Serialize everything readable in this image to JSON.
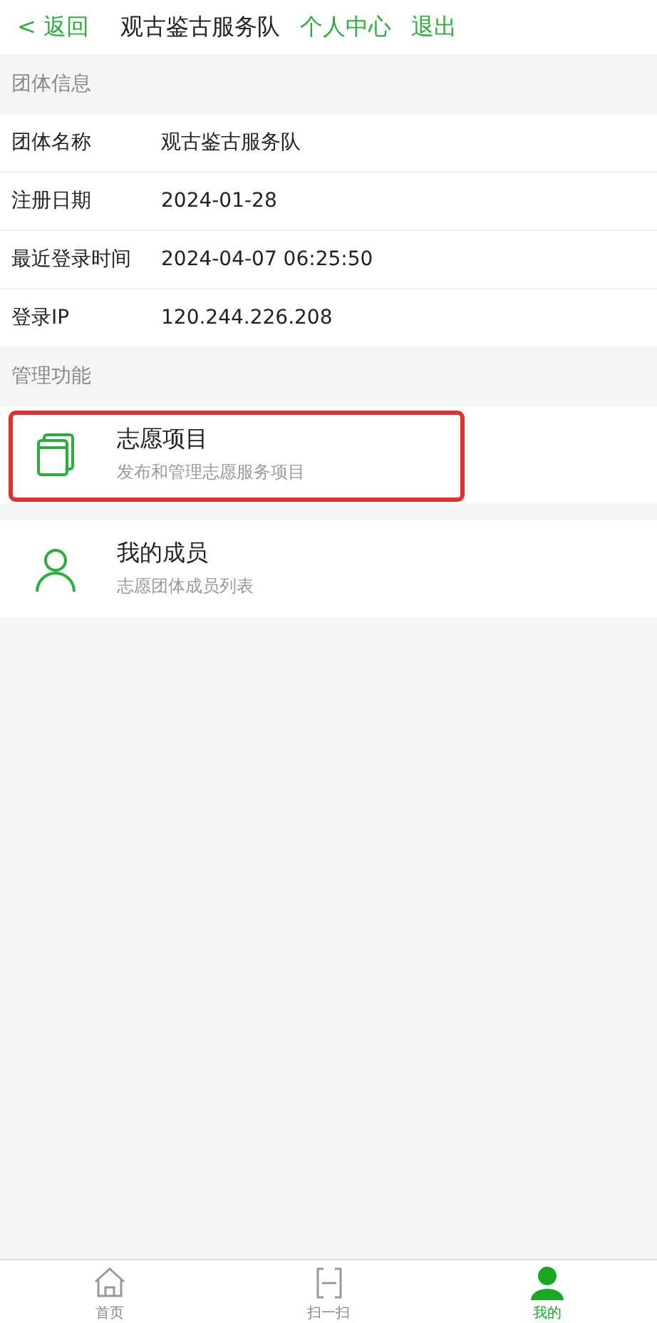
{
  "nav": {
    "back": "< 返回",
    "title": "观古鉴古服务队",
    "links": [
      "个人中心",
      "退出"
    ]
  },
  "info_section": {
    "title": "团体信息",
    "rows": [
      {
        "label": "团体名称",
        "value": "观古鉴古服务队"
      },
      {
        "label": "注册日期",
        "value": "2024-01-28"
      },
      {
        "label": "最近登录时间",
        "value": "2024-04-07 06:25:50"
      },
      {
        "label": "登录IP",
        "value": "120.244.226.208"
      }
    ]
  },
  "manage_section": {
    "title": "管理功能",
    "items": [
      {
        "kind": "folder",
        "title": "志愿项目",
        "subtitle": "发布和管理志愿服务项目",
        "highlighted": true
      },
      {
        "kind": "person",
        "title": "我的成员",
        "subtitle": "志愿团体成员列表",
        "highlighted": false
      }
    ]
  },
  "tab_bar": [
    {
      "kind": "home",
      "label": "首页",
      "selected": false
    },
    {
      "kind": "scan",
      "label": "扫一扫",
      "selected": false
    },
    {
      "kind": "user",
      "label": "我的",
      "selected": true
    }
  ]
}
